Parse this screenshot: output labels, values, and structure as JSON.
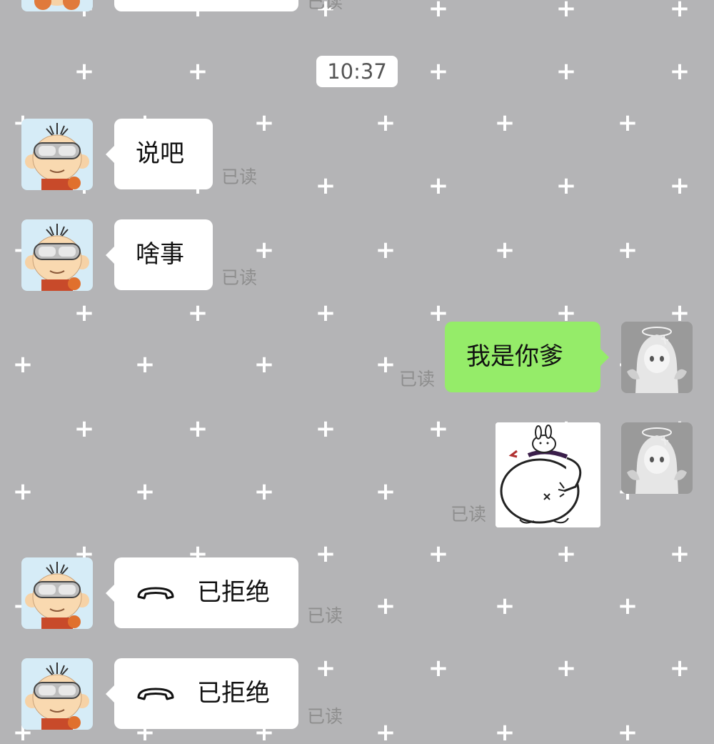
{
  "timestamp": "10:37",
  "read_label": "已读",
  "messages": [
    {
      "side": "in",
      "type": "text",
      "text": "说吧",
      "avatar": "cartoon-boy-avatar"
    },
    {
      "side": "in",
      "type": "text",
      "text": "啥事",
      "avatar": "cartoon-boy-avatar"
    },
    {
      "side": "out",
      "type": "text",
      "text": "我是你爹",
      "avatar": "anime-angel-avatar"
    },
    {
      "side": "out",
      "type": "sticker",
      "sticker": "fat-rabbit-sticker",
      "avatar": "anime-angel-avatar"
    },
    {
      "side": "in",
      "type": "call",
      "icon": "hang-up-phone-icon",
      "text": "已拒绝",
      "avatar": "cartoon-boy-avatar"
    },
    {
      "side": "in",
      "type": "call",
      "icon": "hang-up-phone-icon",
      "text": "已拒绝",
      "avatar": "cartoon-boy-avatar"
    }
  ],
  "top_partial": {
    "read_label": "已读"
  },
  "colors": {
    "background": "#b4b4b6",
    "incoming_bubble": "#ffffff",
    "outgoing_bubble": "#95ec69",
    "read_text": "#8e8e8e"
  }
}
